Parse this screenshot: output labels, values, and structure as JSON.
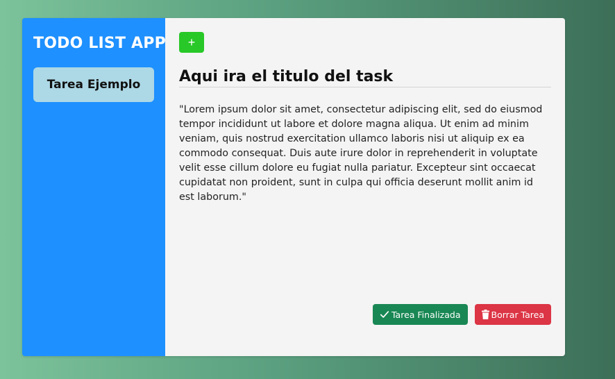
{
  "sidebar": {
    "title": "TODO LIST APP",
    "items": [
      {
        "label": "Tarea Ejemplo"
      }
    ]
  },
  "toolbar": {
    "add_label": "+"
  },
  "task": {
    "title": "Aqui ira el titulo del task",
    "description": "\"Lorem ipsum dolor sit amet, consectetur adipiscing elit, sed do eiusmod tempor incididunt ut labore et dolore magna aliqua. Ut enim ad minim veniam, quis nostrud exercitation ullamco laboris nisi ut aliquip ex ea commodo consequat. Duis aute irure dolor in reprehenderit in voluptate velit esse cillum dolore eu fugiat nulla pariatur. Excepteur sint occaecat cupidatat non proident, sunt in culpa qui officia deserunt mollit anim id est laborum.\""
  },
  "actions": {
    "done_label": "Tarea Finalizada",
    "done_icon": "check-icon",
    "delete_label": "Borrar Tarea",
    "delete_icon": "trash-icon"
  },
  "colors": {
    "sidebar": "#1e90ff",
    "task_item": "#add8e6",
    "add_button": "#28c828",
    "done_button": "#198754",
    "delete_button": "#dc3545"
  }
}
